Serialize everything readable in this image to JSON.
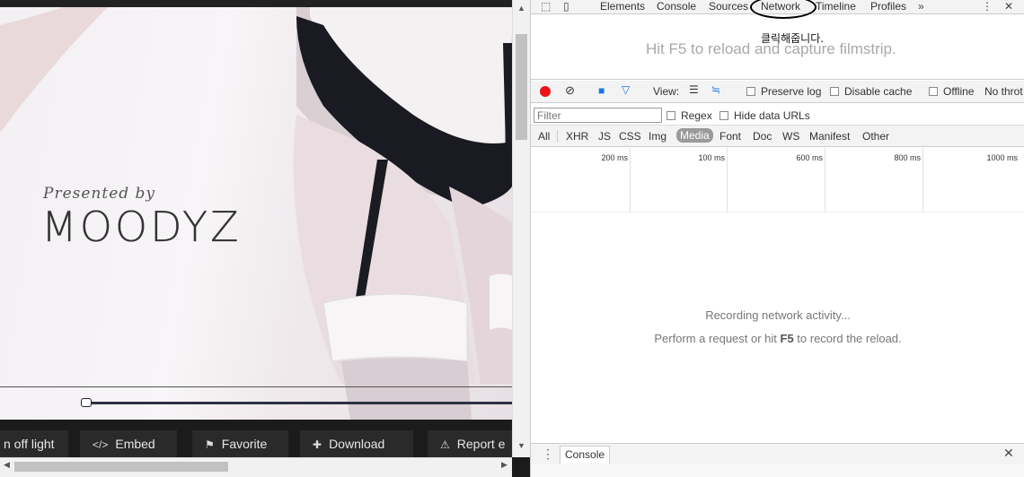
{
  "video": {
    "brand_pre": "Presented by",
    "brand_name": "MOODYZ"
  },
  "actions": [
    {
      "icon": "",
      "label": "n off light"
    },
    {
      "icon": "</>",
      "label": "Embed"
    },
    {
      "icon": "⚑",
      "label": "Favorite"
    },
    {
      "icon": "✚",
      "label": "Download"
    },
    {
      "icon": "⚠",
      "label": "Report e"
    }
  ],
  "devtools": {
    "tabs": [
      "Elements",
      "Console",
      "Sources",
      "Network",
      "Timeline",
      "Profiles"
    ],
    "more": "»",
    "menu": "⋮",
    "close": "✕",
    "annotation": "클릭해줍니다.",
    "filmstrip_msg": "Hit F5 to reload and capture filmstrip.",
    "toolbar": {
      "view_label": "View:",
      "preserve_log": "Preserve log",
      "disable_cache": "Disable cache",
      "offline": "Offline",
      "throttle": "No throt"
    },
    "filter": {
      "placeholder": "Filter",
      "regex": "Regex",
      "hide_data_urls": "Hide data URLs"
    },
    "types": [
      "All",
      "XHR",
      "JS",
      "CSS",
      "Img",
      "Media",
      "Font",
      "Doc",
      "WS",
      "Manifest",
      "Other"
    ],
    "active_type": "Media",
    "timeline_ticks": [
      "200 ms",
      "100 ms",
      "600 ms",
      "800 ms",
      "1000 ms"
    ],
    "empty_line1": "Recording network activity...",
    "empty_line2_pre": "Perform a request or hit ",
    "empty_line2_key": "F5",
    "empty_line2_post": " to record the reload.",
    "drawer_tab": "Console"
  }
}
